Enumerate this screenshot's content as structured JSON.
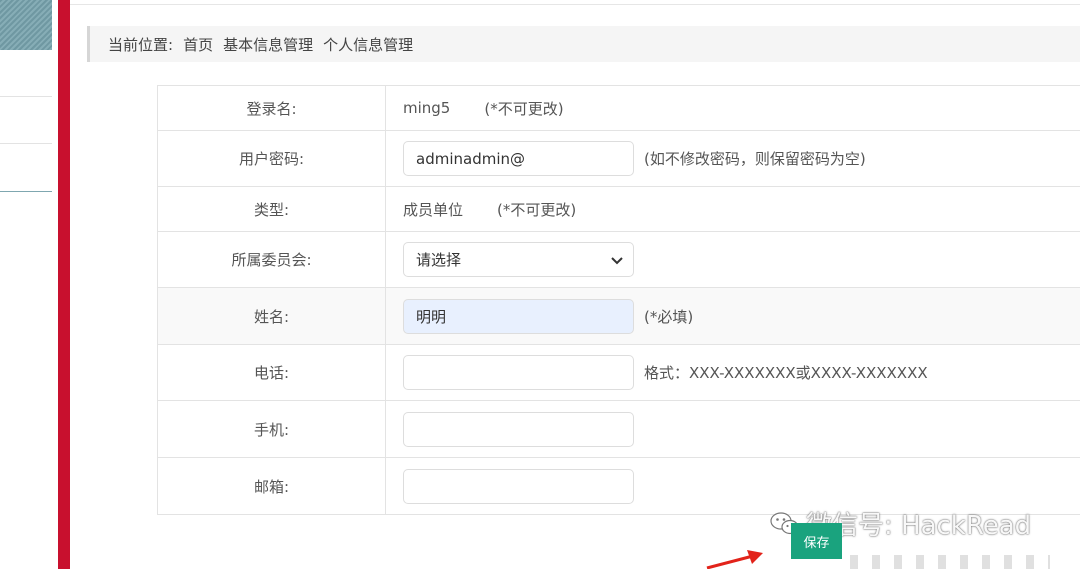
{
  "breadcrumb": {
    "prefix": "当前位置:",
    "items": [
      "首页",
      "基本信息管理",
      "个人信息管理"
    ]
  },
  "form": {
    "login": {
      "label": "登录名:",
      "value": "ming5",
      "note": "(*不可更改)"
    },
    "password": {
      "label": "用户密码:",
      "value": "adminadmin@",
      "hint": "(如不修改密码，则保留密码为空)"
    },
    "type": {
      "label": "类型:",
      "value": "成员单位",
      "note": "(*不可更改)"
    },
    "committee": {
      "label": "所属委员会:",
      "selected": "请选择"
    },
    "name": {
      "label": "姓名:",
      "value": "明明",
      "hint": "(*必填)"
    },
    "phone": {
      "label": "电话:",
      "value": "",
      "hint": "格式：XXX-XXXXXXX或XXXX-XXXXXXX"
    },
    "mobile": {
      "label": "手机:",
      "value": ""
    },
    "email": {
      "label": "邮箱:",
      "value": ""
    }
  },
  "actions": {
    "save_label": "保存"
  },
  "watermark": {
    "text": "微信号: HackRead"
  },
  "colors": {
    "accent_red": "#c8102e",
    "save_green": "#1aa37e",
    "autofill_blue": "#e8f0fe"
  }
}
